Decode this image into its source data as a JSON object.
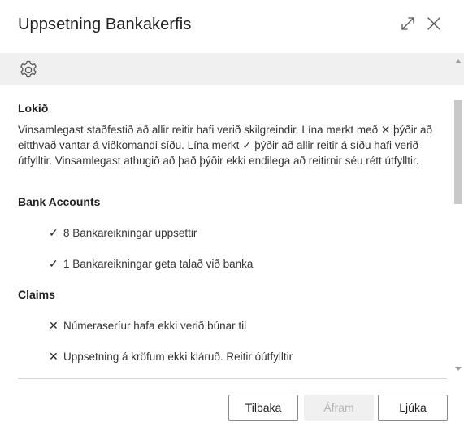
{
  "dialog": {
    "title": "Uppsetning Bankakerfis",
    "icons": {
      "expand": "expand-icon",
      "close": "close-icon",
      "settings": "gear-icon"
    }
  },
  "content": {
    "status_title": "Lokið",
    "intro": "Vinsamlegast staðfestið að allir reitir hafi verið skilgreindir. Lína merkt með ✕ þýðir að eitthvað vantar á viðkomandi síðu. Lína merkt ✓ þýðir að allir reitir á síðu hafi verið útfylltir. Vinsamlegast athugið að það þýðir ekki endilega að reitirnir séu rétt útfylltir.",
    "sections": [
      {
        "title": "Bank Accounts",
        "items": [
          {
            "mark": "✓",
            "text": "8 Bankareikningar uppsettir"
          },
          {
            "mark": "✓",
            "text": "1 Bankareikningar geta talað við banka"
          }
        ]
      },
      {
        "title": "Claims",
        "items": [
          {
            "mark": "✕",
            "text": "Númeraseríur hafa ekki verið búnar til"
          },
          {
            "mark": "✕",
            "text": "Uppsetning á kröfum ekki kláruð. Reitir óútfylltir"
          }
        ]
      }
    ]
  },
  "footer": {
    "back_label": "Tilbaka",
    "next_label": "Áfram",
    "finish_label": "Ljúka"
  }
}
